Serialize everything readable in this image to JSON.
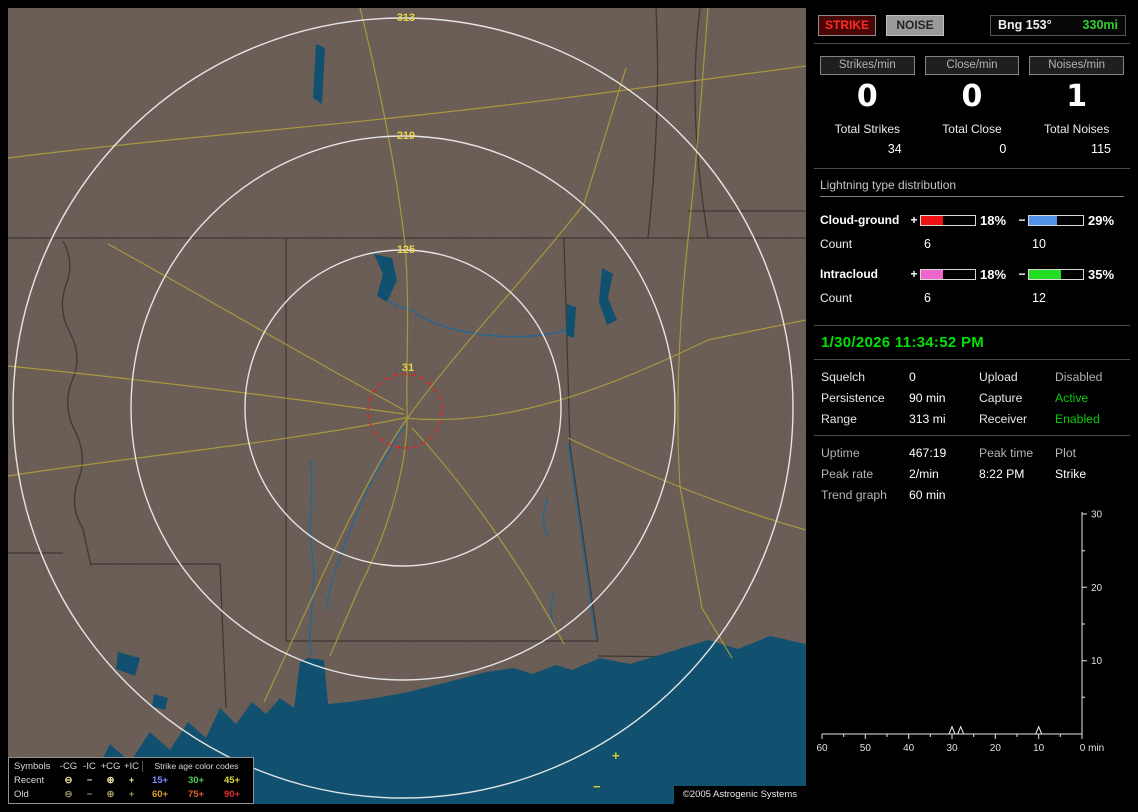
{
  "map": {
    "ring_labels": [
      "313",
      "219",
      "125",
      "31"
    ],
    "strike_markers": [
      {
        "symbol": "+",
        "color": "#d8cc30"
      },
      {
        "symbol": "−",
        "color": "#d8cc30"
      }
    ],
    "legend": {
      "symbols_header": "Symbols",
      "type_headers": [
        "-CG",
        "-IC",
        "+CG",
        "+IC"
      ],
      "age_header": "Strike age color codes",
      "row_recent": {
        "label": "Recent",
        "symbols": [
          "⊖",
          "−",
          "⊕",
          "+"
        ],
        "ages": [
          {
            "text": "15+",
            "color": "#7b8cff"
          },
          {
            "text": "30+",
            "color": "#55c855"
          },
          {
            "text": "45+",
            "color": "#d8d848"
          }
        ]
      },
      "row_old": {
        "label": "Old",
        "symbols": [
          "⊖",
          "−",
          "⊕",
          "+"
        ],
        "ages": [
          {
            "text": "60+",
            "color": "#d8a030"
          },
          {
            "text": "75+",
            "color": "#e06030"
          },
          {
            "text": "90+",
            "color": "#e03030"
          }
        ]
      }
    },
    "copyright": "©2005 Astrogenic Systems"
  },
  "panel": {
    "strike_button": "STRIKE",
    "noise_button": "NOISE",
    "bearing": {
      "label": "Bng 153°",
      "range": "330mi",
      "range_color": "#30d030"
    },
    "counters": [
      {
        "label": "Strikes/min",
        "value": "0",
        "total_label": "Total Strikes",
        "total_value": "34"
      },
      {
        "label": "Close/min",
        "value": "0",
        "total_label": "Total Close",
        "total_value": "0"
      },
      {
        "label": "Noises/min",
        "value": "1",
        "total_label": "Total Noises",
        "total_value": "115"
      }
    ],
    "distribution": {
      "heading": "Lightning type distribution",
      "count_label": "Count",
      "plus_sign": "+",
      "minus_sign": "−",
      "rows": [
        {
          "label": "Cloud-ground",
          "pos_pct": "18%",
          "pos_fill": 40,
          "pos_color": "#ee1111",
          "pos_count": "6",
          "neg_pct": "29%",
          "neg_fill": 52,
          "neg_color": "#4f92e8",
          "neg_count": "10"
        },
        {
          "label": "Intracloud",
          "pos_pct": "18%",
          "pos_fill": 40,
          "pos_color": "#ee66cc",
          "pos_count": "6",
          "neg_pct": "35%",
          "neg_fill": 60,
          "neg_color": "#22dd22",
          "neg_count": "12"
        }
      ]
    },
    "datetime": "1/30/2026 11:34:52 PM",
    "settings": {
      "rows": [
        {
          "label_left": "Squelch",
          "value_left": "0",
          "label_right": "Upload",
          "value_right": "Disabled",
          "value_right_color": "#b0b0b0"
        },
        {
          "label_left": "Persistence",
          "value_left": "90 min",
          "label_right": "Capture",
          "value_right": "Active",
          "value_right_color": "#00cc00"
        },
        {
          "label_left": "Range",
          "value_left": "313 mi",
          "label_right": "Receiver",
          "value_right": "Enabled",
          "value_right_color": "#00cc00"
        }
      ]
    },
    "stats": {
      "uptime_label": "Uptime",
      "uptime_value": "467:19",
      "peak_time_label": "Peak time",
      "peak_time_value": "8:22 PM",
      "plot_label": "Plot",
      "plot_value": "Strike",
      "peak_rate_label": "Peak rate",
      "peak_rate_value": "2/min",
      "trend_label": "Trend graph",
      "trend_value": "60 min"
    }
  },
  "chart_data": {
    "type": "line",
    "title": "Trend graph",
    "window_label": "60 min",
    "xlabel": "min",
    "x_minutes_range": [
      60,
      0
    ],
    "x_tick_labels": [
      "60",
      "50",
      "40",
      "30",
      "20",
      "10",
      "0 min"
    ],
    "y_tick_labels": [
      "10",
      "20",
      "30"
    ],
    "ylim": [
      0,
      30
    ],
    "grid": false,
    "series": [
      {
        "name": "rate-per-min-trend",
        "color": "#f0f0f0",
        "spikes": [
          {
            "min": 30,
            "value": 1
          },
          {
            "min": 28,
            "value": 1
          },
          {
            "min": 10,
            "value": 1
          }
        ]
      }
    ]
  }
}
